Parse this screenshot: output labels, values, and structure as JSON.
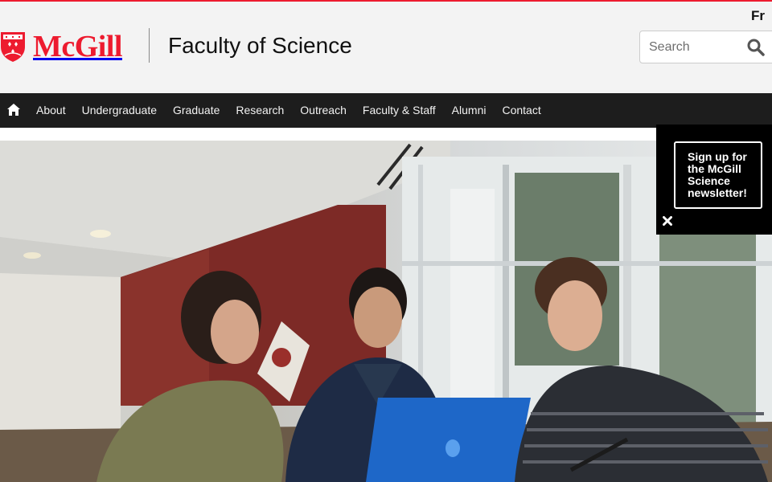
{
  "header": {
    "language_link": "Fr",
    "logo_text": "McGill",
    "faculty_title": "Faculty of Science",
    "search": {
      "placeholder": "Search",
      "value": ""
    }
  },
  "nav": {
    "home_icon": "home-icon",
    "items": [
      {
        "label": "About"
      },
      {
        "label": "Undergraduate"
      },
      {
        "label": "Graduate"
      },
      {
        "label": "Research"
      },
      {
        "label": "Outreach"
      },
      {
        "label": "Faculty & Staff"
      },
      {
        "label": "Alumni"
      },
      {
        "label": "Contact"
      }
    ]
  },
  "newsletter": {
    "lines": [
      "Sign up for",
      "the McGill",
      "Science",
      "newsletter!"
    ],
    "close_icon": "close-icon"
  },
  "colors": {
    "brand_red": "#ed1b2f",
    "nav_bg": "#1d1d1d",
    "header_bg": "#f3f3f3",
    "popup_bg": "#000000"
  }
}
